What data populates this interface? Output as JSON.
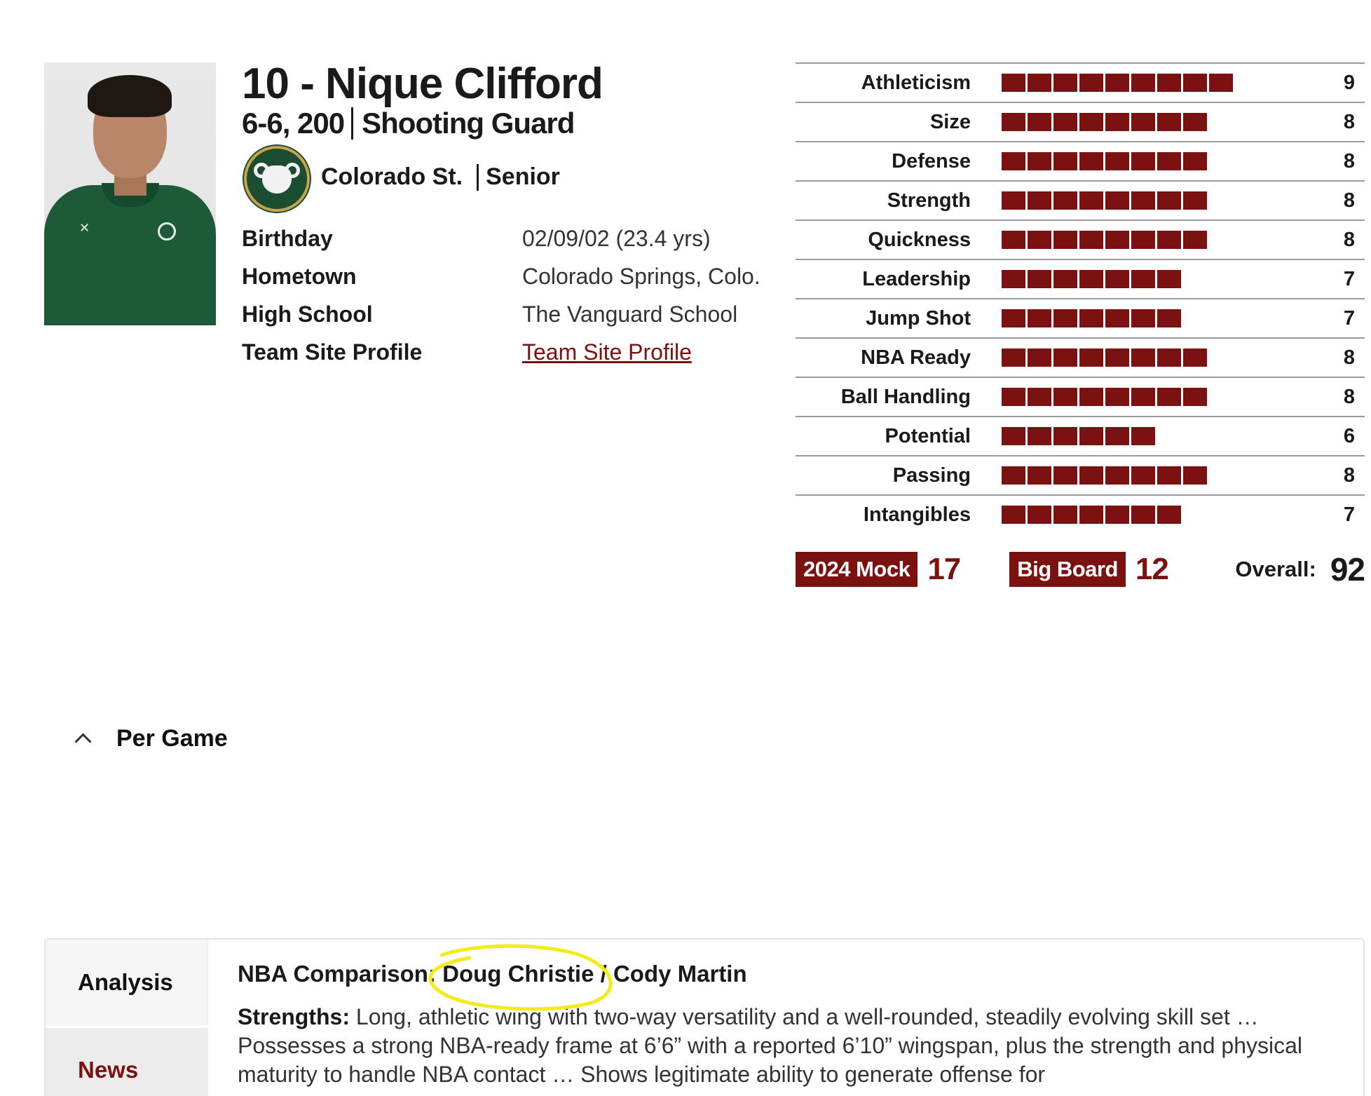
{
  "player": {
    "name": "10 - Nique Clifford",
    "size": "6-6, 200",
    "position": "Shooting Guard",
    "school": "Colorado St.",
    "class_year": "Senior",
    "info": [
      {
        "label": "Birthday",
        "value": "02/09/02 (23.4 yrs)"
      },
      {
        "label": "Hometown",
        "value": "Colorado Springs, Colo."
      },
      {
        "label": "High School",
        "value": "The Vanguard School"
      },
      {
        "label": "Team Site Profile",
        "value": "Team Site Profile"
      }
    ]
  },
  "ratings": [
    {
      "label": "Athleticism",
      "value": 9
    },
    {
      "label": "Size",
      "value": 8
    },
    {
      "label": "Defense",
      "value": 8
    },
    {
      "label": "Strength",
      "value": 8
    },
    {
      "label": "Quickness",
      "value": 8
    },
    {
      "label": "Leadership",
      "value": 7
    },
    {
      "label": "Jump Shot",
      "value": 7
    },
    {
      "label": "NBA Ready",
      "value": 8
    },
    {
      "label": "Ball Handling",
      "value": 8
    },
    {
      "label": "Potential",
      "value": 6
    },
    {
      "label": "Passing",
      "value": 8
    },
    {
      "label": "Intangibles",
      "value": 7
    }
  ],
  "ranks": {
    "mock_label": "2024 Mock",
    "mock_value": "17",
    "board_label": "Big Board",
    "board_value": "12",
    "overall_label": "Overall:",
    "overall_value": "92"
  },
  "per_game": {
    "label": "Per Game"
  },
  "panel": {
    "tabs": [
      {
        "label": "Analysis"
      },
      {
        "label": "News"
      }
    ],
    "comparison": "NBA Comparison: Doug Christie / Cody Martin",
    "strengths_label": "Strengths:",
    "strengths_text": "Long, athletic wing with two-way versatility and a well-rounded, steadily evolving skill set … Possesses a strong NBA-ready frame at 6’6” with a reported 6’10” wingspan, plus the strength and physical maturity to handle NBA contact … Shows legitimate ability to generate offense for"
  },
  "colors": {
    "accent": "#7b1111",
    "highlight": "#f5ea1e",
    "school_green": "#1b4d31"
  },
  "icons": {
    "collapse": "chevron-up-icon",
    "school": "colorado-state-rams-logo"
  }
}
